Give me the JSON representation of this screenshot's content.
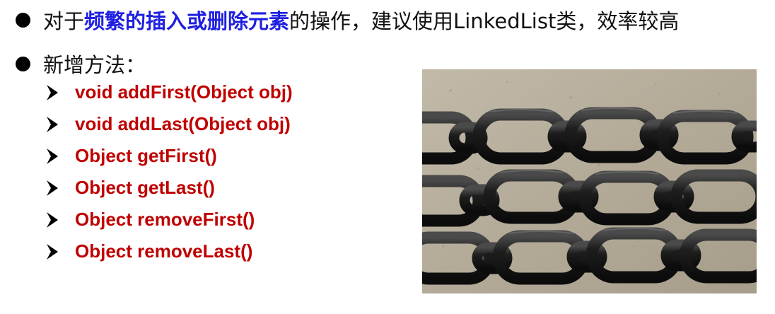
{
  "bullet1": {
    "prefix": "对于",
    "highlight": "频繁的插入或删除元素",
    "suffix": "的操作，建议使用LinkedList类，效率较高"
  },
  "bullet2": {
    "text": "新增方法："
  },
  "methods": [
    "void addFirst(Object obj)",
    "void addLast(Object obj)",
    "Object getFirst()",
    "Object getLast()",
    "Object removeFirst()",
    "Object removeLast()"
  ],
  "colors": {
    "highlight": "#1f1fe0",
    "method_text": "#c00000",
    "chain": "#1b1b1b",
    "ground": "#b4ab9a"
  },
  "icons": {
    "bullet": "filled-circle",
    "sub_bullet": "arrowhead-marker"
  },
  "image": {
    "subject": "photo of heavy black steel chains lying on concrete"
  }
}
